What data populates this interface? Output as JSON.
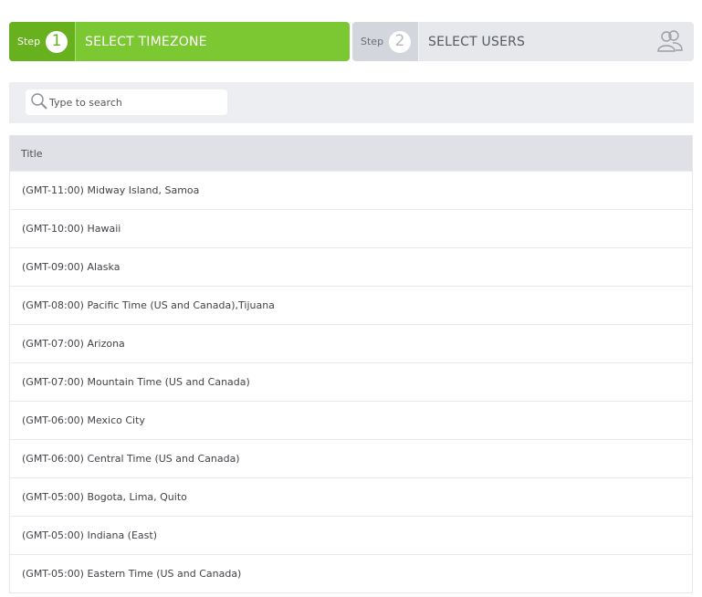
{
  "wizard": {
    "step1": {
      "word": "Step",
      "number": "1",
      "title": "SELECT TIMEZONE"
    },
    "step2": {
      "word": "Step",
      "number": "2",
      "title": "SELECT USERS",
      "icon": "users-icon"
    }
  },
  "search": {
    "placeholder": "Type to search",
    "value": ""
  },
  "table": {
    "header": "Title",
    "rows": [
      "(GMT-11:00) Midway Island, Samoa",
      "(GMT-10:00) Hawaii",
      "(GMT-09:00) Alaska",
      "(GMT-08:00) Pacific Time (US and Canada),Tijuana",
      "(GMT-07:00) Arizona",
      "(GMT-07:00) Mountain Time (US and Canada)",
      "(GMT-06:00) Mexico City",
      "(GMT-06:00) Central Time (US and Canada)",
      "(GMT-05:00) Bogota, Lima, Quito",
      "(GMT-05:00) Indiana (East)",
      "(GMT-05:00) Eastern Time (US and Canada)"
    ]
  },
  "colors": {
    "active_step": "#7bc832",
    "active_badge": "#67b11f",
    "inactive_step": "#e6e8ec"
  }
}
